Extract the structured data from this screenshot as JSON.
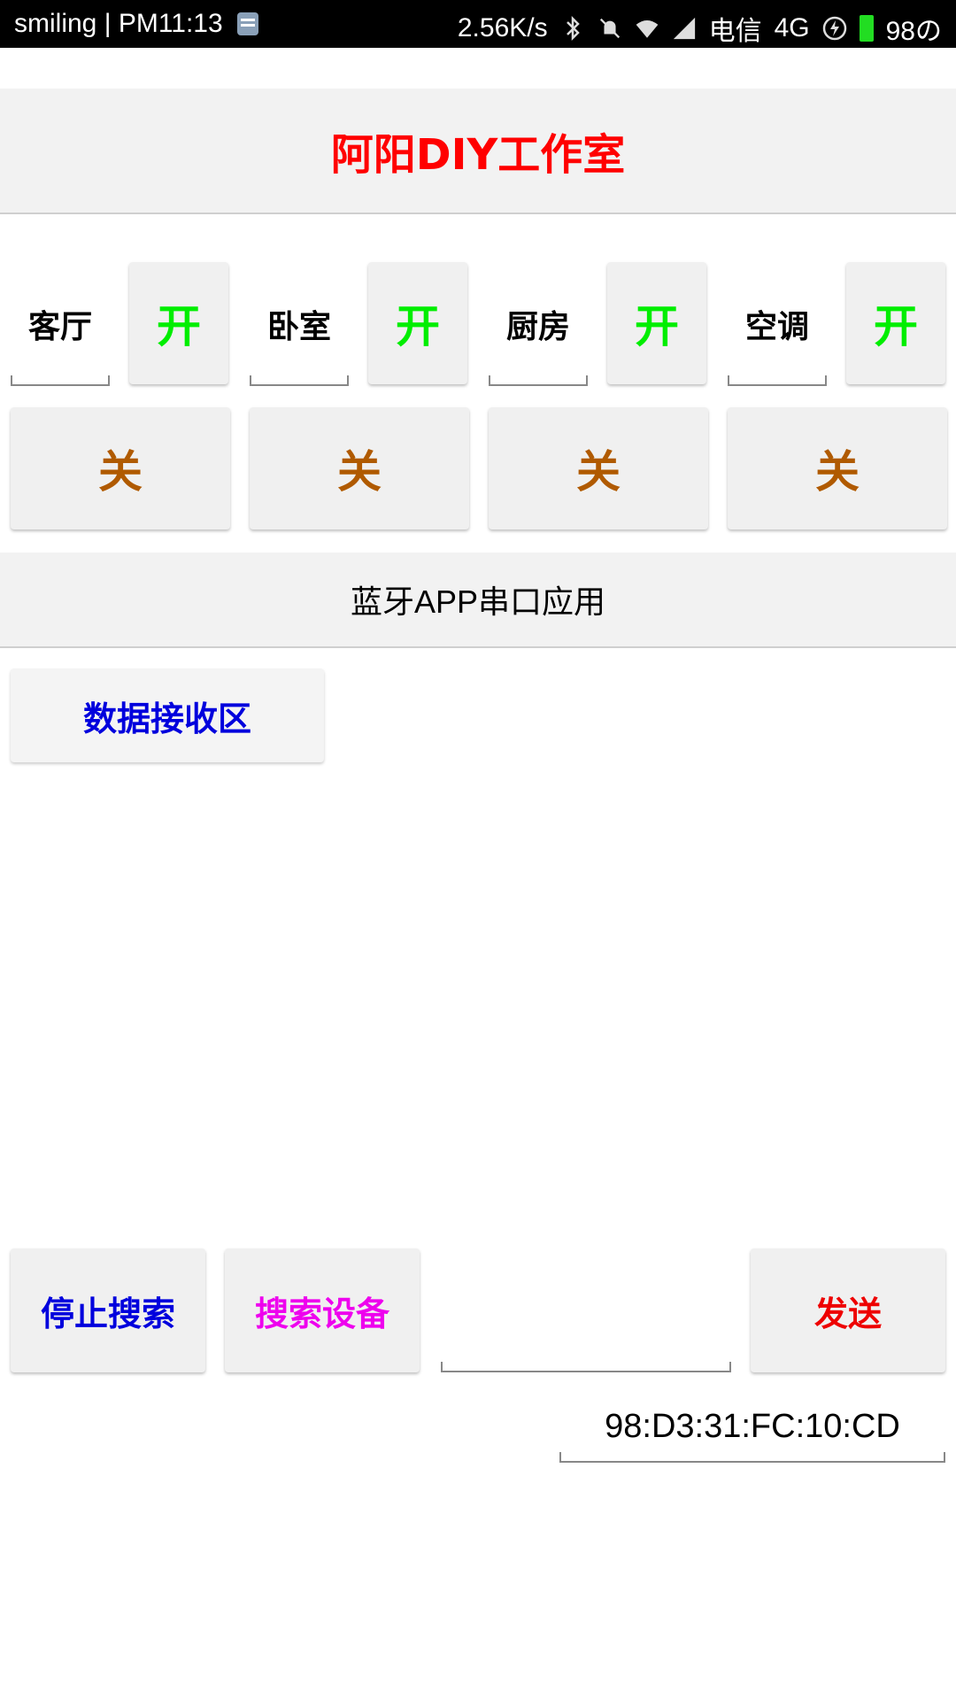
{
  "status_bar": {
    "carrier_text": "smiling | PM11:13",
    "speed": "2.56K/s",
    "network_name": "电信",
    "network_type": "4G",
    "battery": "98の",
    "battery_color": "#22dd22"
  },
  "app": {
    "title": "阿阳DIY工作室",
    "title_color": "#ff0000"
  },
  "rooms": [
    {
      "label": "客厅",
      "on_label": "开",
      "off_label": "关"
    },
    {
      "label": "卧室",
      "on_label": "开",
      "off_label": "关"
    },
    {
      "label": "厨房",
      "on_label": "开",
      "off_label": "关"
    },
    {
      "label": "空调",
      "on_label": "开",
      "off_label": "关"
    }
  ],
  "section": {
    "subtitle": "蓝牙APP串口应用",
    "receive_label": "数据接收区",
    "receive_content": ""
  },
  "controls": {
    "stop_search_label": "停止搜索",
    "search_device_label": "搜索设备",
    "send_label": "发送",
    "send_input_value": "",
    "mac_address": "98:D3:31:FC:10:CD"
  },
  "colors": {
    "on": "#00ee00",
    "off": "#b05a00",
    "blue": "#0000dd",
    "magenta": "#ee00ee",
    "red": "#ee0000"
  }
}
